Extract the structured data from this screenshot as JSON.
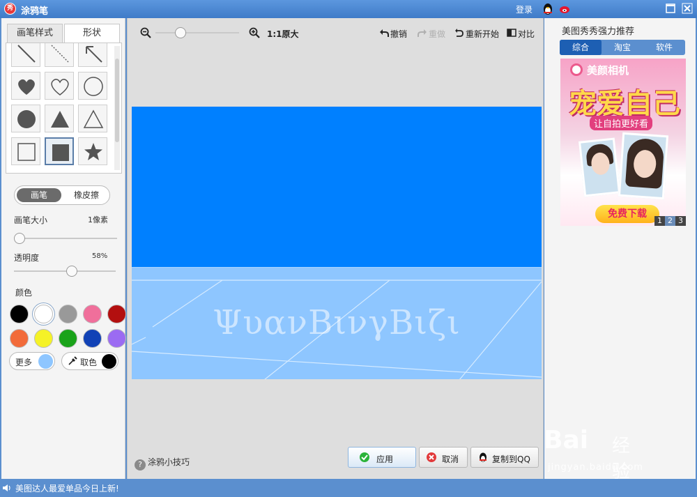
{
  "titlebar": {
    "logo_char": "秀",
    "title": "涂鸦笔",
    "login": "登录"
  },
  "left_panel": {
    "tabs": [
      "画笔样式",
      "形状"
    ],
    "mode": {
      "brush": "画笔",
      "eraser": "橡皮擦"
    },
    "brush_size": {
      "label": "画笔大小",
      "value": "1像素",
      "fraction": 0.0
    },
    "opacity": {
      "label": "透明度",
      "value": "58%",
      "fraction": 0.58
    },
    "color_label": "颜色",
    "colors": [
      "#000000",
      "#ffffff",
      "#999999",
      "#f06f9b",
      "#b30f0f",
      "#f26b3a",
      "#f5f227",
      "#1aa31a",
      "#1142b6",
      "#9b6bf2"
    ],
    "selected_color_index": 1,
    "more_label": "更多",
    "more_color": "#8ec6ff",
    "pick_label": "取色",
    "pick_color": "#000000"
  },
  "toolbar": {
    "zoom_text": "1:1原大",
    "undo": "撤销",
    "redo": "重做",
    "restart": "重新开始",
    "compare": "对比"
  },
  "canvas": {
    "watermark": "ΨυανΒινγΒιζι",
    "top_color": "#0080ff",
    "bottom_color": "#8ec6ff"
  },
  "bottom": {
    "tips": "涂鸦小技巧",
    "apply": "应用",
    "cancel": "取消",
    "copy_qq": "复制到QQ"
  },
  "right_panel": {
    "heading": "美图秀秀强力推荐",
    "tabs": [
      "综合",
      "淘宝",
      "软件"
    ],
    "ad": {
      "brand": "美颜相机",
      "headline": "宠爱自己",
      "subline": "让自拍更好看",
      "cta": "免费下载",
      "pages": [
        "1",
        "2",
        "3"
      ]
    }
  },
  "status": {
    "message": "美图达人最爱单品今日上新!"
  },
  "watermark_site": {
    "brand": "Bai",
    "cn": "经验",
    "url": "jingyan.baidu.com"
  }
}
